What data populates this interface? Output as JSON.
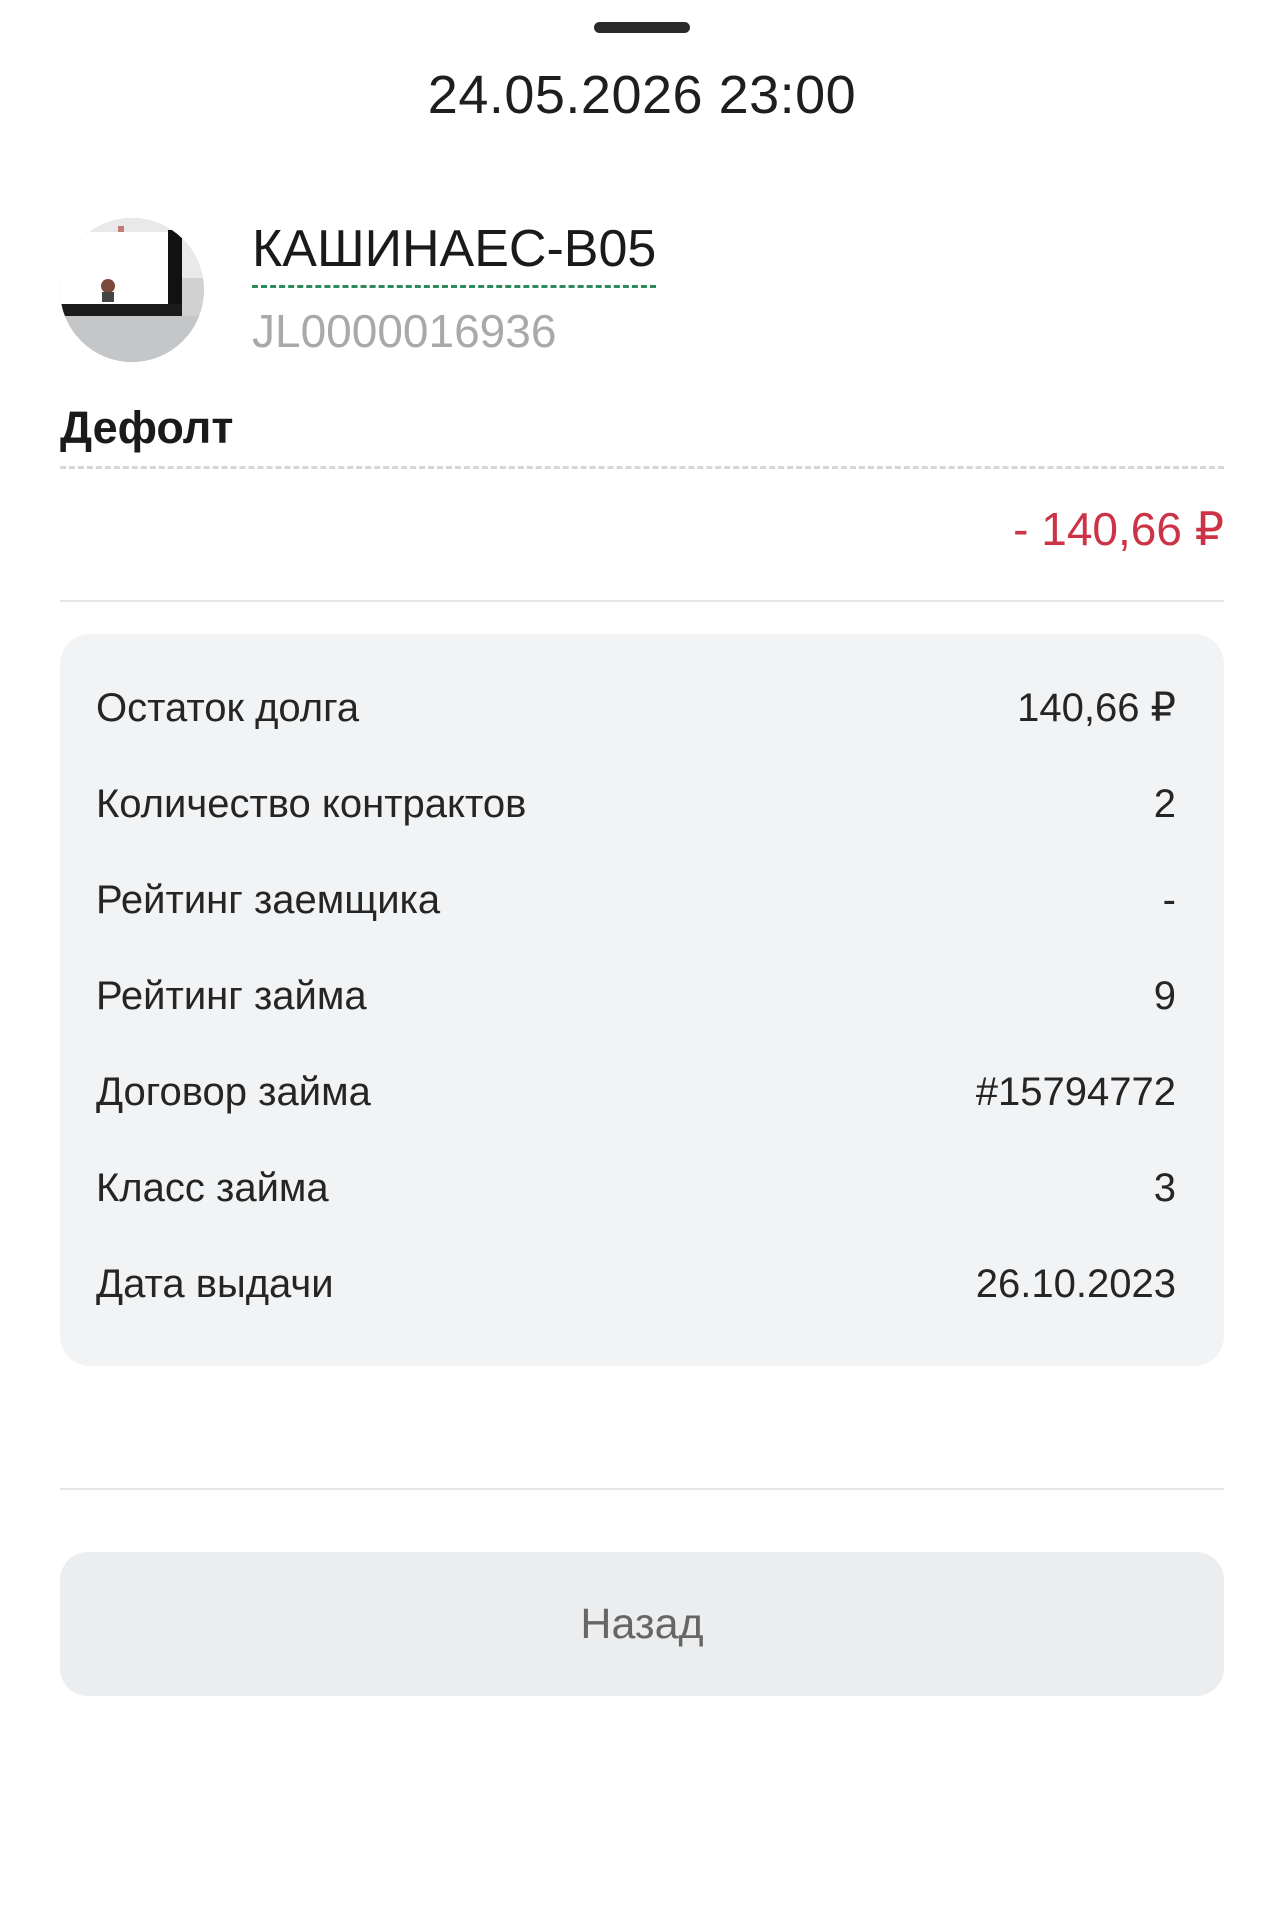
{
  "sheet": {
    "title": "24.05.2026 23:00"
  },
  "borrower": {
    "name": "КАШИНАЕС-В05",
    "id": "JL0000016936",
    "avatar": "avatar-photo"
  },
  "status": {
    "label": "Дефолт",
    "amount": "- 140,66 ₽",
    "amount_color": "#cc3347"
  },
  "details": [
    {
      "label": "Остаток долга",
      "value": "140,66 ₽"
    },
    {
      "label": "Количество контрактов",
      "value": "2"
    },
    {
      "label": "Рейтинг заемщика",
      "value": "-"
    },
    {
      "label": "Рейтинг займа",
      "value": "9"
    },
    {
      "label": "Договор займа",
      "value": "#15794772"
    },
    {
      "label": "Класс займа",
      "value": "3"
    },
    {
      "label": "Дата выдачи",
      "value": "26.10.2023"
    }
  ],
  "actions": {
    "back_label": "Назад"
  },
  "colors": {
    "accent_underline": "#2f8a5a",
    "negative": "#cc3347",
    "card_background": "#f2f3f4"
  }
}
